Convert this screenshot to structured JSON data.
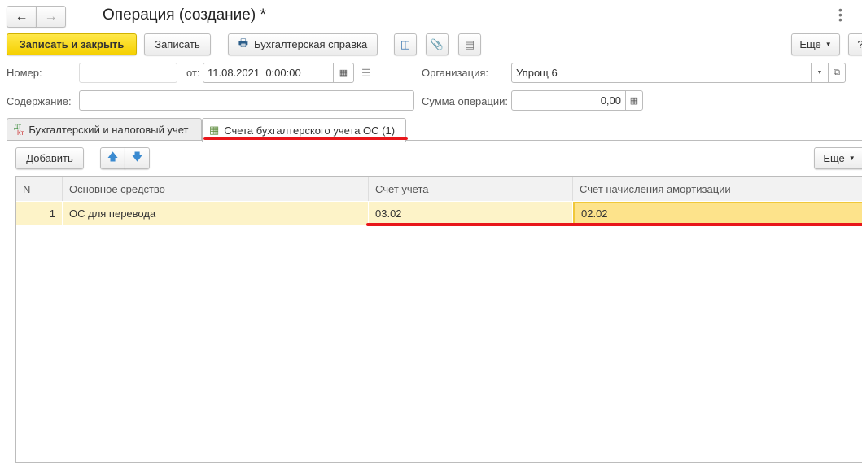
{
  "window": {
    "title": "Операция (создание) *"
  },
  "toolbar": {
    "save_close": "Записать и закрыть",
    "save": "Записать",
    "report": "Бухгалтерская справка",
    "more": "Еще",
    "help": "?"
  },
  "form": {
    "number_label": "Номер:",
    "number_value": "",
    "date_label": "от:",
    "date_value": "11.08.2021  0:00:00",
    "org_label": "Организация:",
    "org_value": "Упрощ 6",
    "content_label": "Содержание:",
    "content_value": "",
    "sum_label": "Сумма операции:",
    "sum_value": "0,00"
  },
  "tabs": [
    {
      "label": "Бухгалтерский и налоговый учет",
      "icon_text": "Дт Кт"
    },
    {
      "label": "Счета бухгалтерского учета ОС (1)",
      "active": true
    }
  ],
  "table_toolbar": {
    "add": "Добавить",
    "more": "Еще"
  },
  "table": {
    "columns": [
      "N",
      "Основное средство",
      "Счет учета",
      "Счет начисления амортизации"
    ],
    "rows": [
      {
        "n": "1",
        "asset": "ОС для перевода",
        "account": "03.02",
        "depr_account": "02.02"
      }
    ]
  },
  "colors": {
    "accent_yellow": "#f5d000",
    "highlight": "#e8161b",
    "row": "#fdf3c8",
    "selected_cell": "#fde38b"
  }
}
